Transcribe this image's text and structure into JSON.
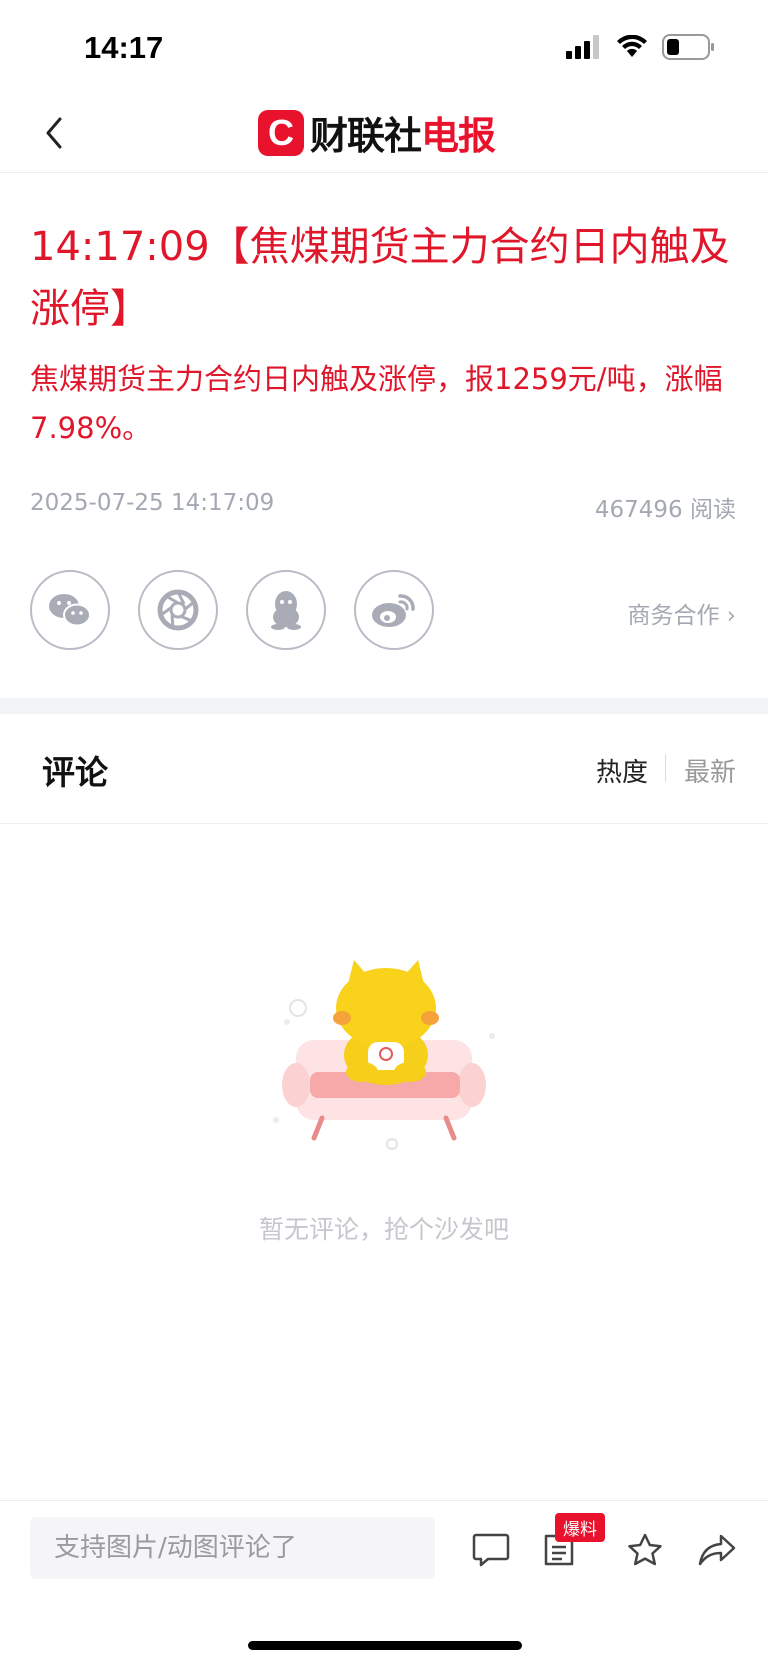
{
  "status": {
    "time": "14:17"
  },
  "nav": {
    "logo_mark": "C",
    "logo_text_black": "财联社",
    "logo_text_red": "电报"
  },
  "article": {
    "headline": "14:17:09【焦煤期货主力合约日内触及涨停】",
    "summary": "焦煤期货主力合约日内触及涨停，报1259元/吨，涨幅7.98%。",
    "date": "2025-07-25 14:17:09",
    "reads": "467496 阅读",
    "business_link": "商务合作 ›"
  },
  "share": {
    "icons": [
      "wechat-icon",
      "moments-icon",
      "qq-icon",
      "weibo-icon"
    ]
  },
  "comments": {
    "title": "评论",
    "sort_hot": "热度",
    "sort_new": "最新",
    "empty_text": "暂无评论，抢个沙发吧"
  },
  "bottom": {
    "input_placeholder": "支持图片/动图评论了",
    "tip_badge": "爆料"
  },
  "colors": {
    "brand_red": "#e8122d",
    "headline_red": "#e0162b",
    "meta_gray": "#a3a8b2"
  }
}
